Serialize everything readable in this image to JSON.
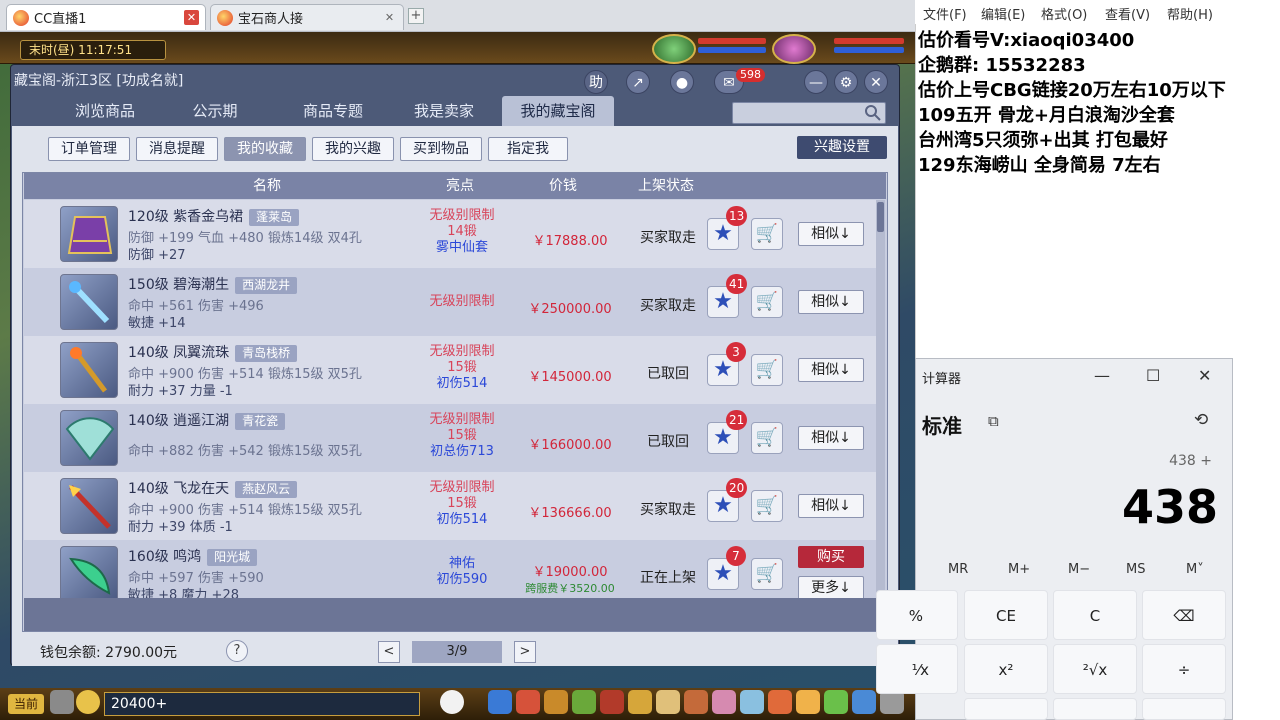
{
  "browser": {
    "tabs": [
      {
        "label": "CC直播1",
        "active": true
      },
      {
        "label": "宝石商人接",
        "active": false
      }
    ],
    "close_glyph": "✕",
    "new_tab_glyph": "+"
  },
  "game": {
    "time_text": "末时(昼)  11:17:51",
    "dialog": {
      "title": "藏宝阁-浙江3区 [功成名就]",
      "help_label": "助",
      "message_badge": "598",
      "main_tabs": [
        "浏览商品",
        "公示期",
        "商品专题",
        "我是卖家",
        "我的藏宝阁"
      ],
      "active_main_tab": 4,
      "sub_tabs": [
        "订单管理",
        "消息提醒",
        "我的收藏",
        "我的兴趣",
        "买到物品",
        "指定我"
      ],
      "active_sub_tab": 2,
      "interest_settings_label": "兴趣设置",
      "columns": {
        "name": "名称",
        "highlight": "亮点",
        "price": "价钱",
        "status": "上架状态"
      },
      "rows": [
        {
          "icon": "purple-skirt-icon",
          "name": "120级 紫香金乌裙",
          "server": "蓬莱岛",
          "stat1": "防御 +199 气血 +480 锻炼14级 双4孔",
          "stat2": "防御 +27",
          "hl1": "无级别限制",
          "hl2": "14锻",
          "hl3": "雾中仙套",
          "price": "￥17888.00",
          "fee": "",
          "status": "买家取走",
          "stars": "13",
          "action": "相似↓",
          "action2": ""
        },
        {
          "icon": "crystal-wand-icon",
          "name": "150级 碧海潮生",
          "server": "西湖龙井",
          "stat1": "命中 +561 伤害 +496",
          "stat2": "敏捷 +14",
          "hl1": "无级别限制",
          "hl2": "",
          "hl3": "",
          "price": "￥250000.00",
          "fee": "",
          "status": "买家取走",
          "stars": "41",
          "action": "相似↓",
          "action2": ""
        },
        {
          "icon": "golden-staff-icon",
          "name": "140级 凤翼流珠",
          "server": "青岛栈桥",
          "stat1": "命中 +900 伤害 +514 锻炼15级 双5孔",
          "stat2": "耐力 +37 力量 -1",
          "hl1": "无级别限制",
          "hl2": "15锻",
          "hl3": "初伤514",
          "price": "￥145000.00",
          "fee": "",
          "status": "已取回",
          "stars": "3",
          "action": "相似↓",
          "action2": ""
        },
        {
          "icon": "jade-fan-icon",
          "name": "140级 逍遥江湖",
          "server": "青花瓷",
          "stat1": "命中 +882 伤害 +542 锻炼15级 双5孔",
          "stat2": "",
          "hl1": "无级别限制",
          "hl2": "15锻",
          "hl3": "初总伤713",
          "price": "￥166000.00",
          "fee": "",
          "status": "已取回",
          "stars": "21",
          "action": "相似↓",
          "action2": ""
        },
        {
          "icon": "dragon-spear-icon",
          "name": "140级 飞龙在天",
          "server": "燕赵风云",
          "stat1": "命中 +900 伤害 +514 锻炼15级 双5孔",
          "stat2": "耐力 +39 体质 -1",
          "hl1": "无级别限制",
          "hl2": "15锻",
          "hl3": "初伤514",
          "price": "￥136666.00",
          "fee": "",
          "status": "买家取走",
          "stars": "20",
          "action": "相似↓",
          "action2": ""
        },
        {
          "icon": "green-blade-icon",
          "name": "160级 鸣鸿",
          "server": "阳光城",
          "stat1": "命中 +597 伤害 +590",
          "stat2": "敏捷 +8 魔力 +28",
          "hl1": "神佑",
          "hl2": "初伤590",
          "hl3": "",
          "price": "￥19000.00",
          "fee": "跨服费￥3520.00",
          "status": "正在上架",
          "stars": "7",
          "action": "购买",
          "action2": "更多↓"
        }
      ],
      "wallet": "钱包余额: 2790.00元",
      "help_glyph": "?",
      "page": "3/9",
      "prev_glyph": "<",
      "next_glyph": ">"
    },
    "bottom": {
      "channel": "当前",
      "counter": "20400+"
    }
  },
  "notepad": {
    "menu": [
      "文件(F)",
      "编辑(E)",
      "格式(O)",
      "查看(V)",
      "帮助(H)"
    ],
    "lines": [
      "估价看号V:xiaoqi03400",
      "企鹅群: 15532283",
      "估价上号CBG链接20万左右10万以下",
      "109五开 骨龙+月白浪淘沙全套",
      "台州湾5只须弥+出其 打包最好",
      "129东海崂山 全身简易  7左右"
    ]
  },
  "calculator": {
    "title": "计算器",
    "mode": "标准",
    "expression": "438 +",
    "result": "438",
    "memory": [
      "MR",
      "M+",
      "M−",
      "MS",
      "M˅"
    ],
    "keys_row1": [
      "%",
      "CE",
      "C",
      "⌫"
    ],
    "keys_row2": [
      "¹⁄x",
      "x²",
      "²√x",
      "÷"
    ],
    "window_controls": [
      "—",
      "☐",
      "✕"
    ]
  }
}
